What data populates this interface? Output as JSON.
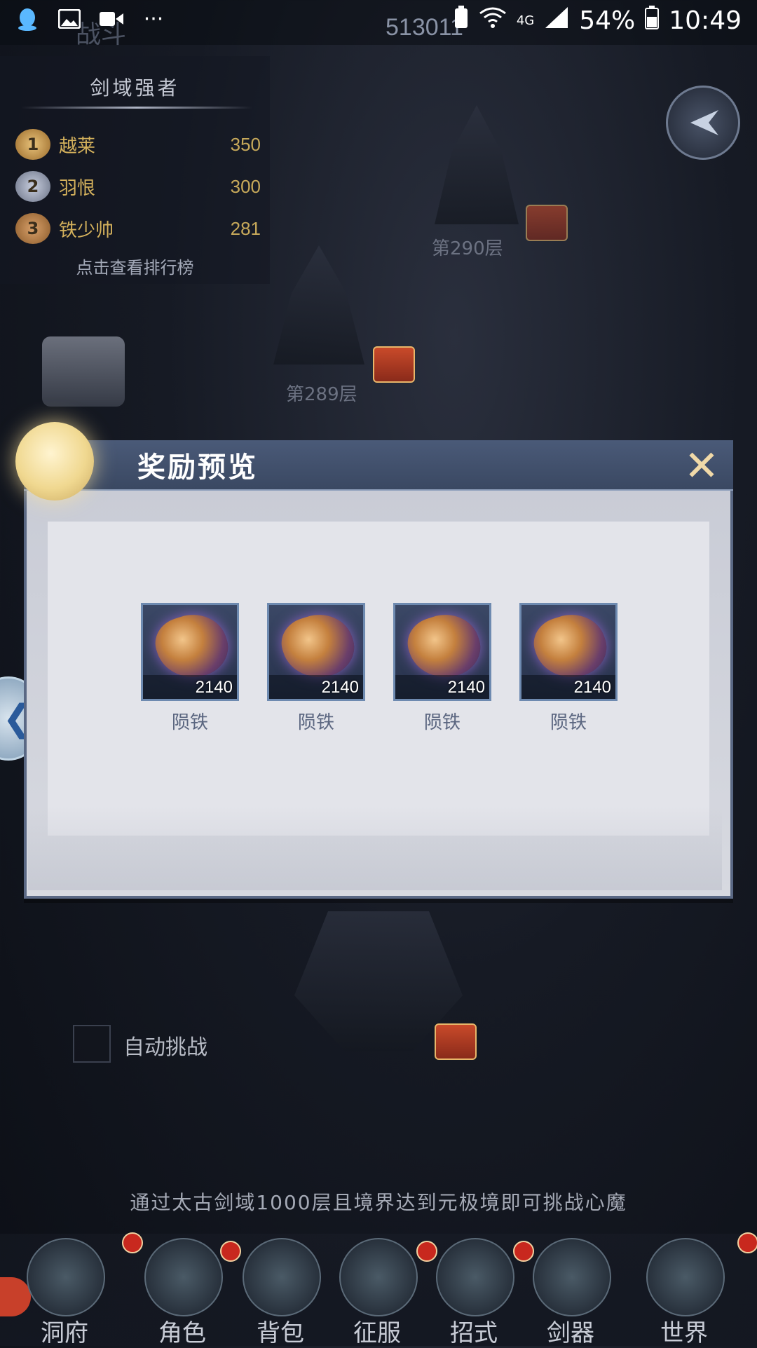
{
  "status_bar": {
    "battery": "54%",
    "time": "10:49",
    "network": "4G",
    "faint_title": "战斗",
    "faint_score": "513011",
    "icons": [
      "qq-icon",
      "image-icon",
      "video-icon",
      "more-icon",
      "battery-saver-icon",
      "wifi-icon",
      "signal-icon",
      "battery-icon"
    ]
  },
  "leaderboard": {
    "title": "剑域强者",
    "entries": [
      {
        "rank": "1",
        "name": "越莱",
        "score": "350"
      },
      {
        "rank": "2",
        "name": "羽恨",
        "score": "300"
      },
      {
        "rank": "3",
        "name": "铁少帅",
        "score": "281"
      }
    ],
    "link": "点击查看排行榜"
  },
  "floors": {
    "floor_a": "第290层",
    "floor_b": "第289层"
  },
  "dialog": {
    "title": "奖励预览",
    "items": [
      {
        "name": "陨铁",
        "count": "2140",
        "icon": "meteoric-iron-icon"
      },
      {
        "name": "陨铁",
        "count": "2140",
        "icon": "meteoric-iron-icon"
      },
      {
        "name": "陨铁",
        "count": "2140",
        "icon": "meteoric-iron-icon"
      },
      {
        "name": "陨铁",
        "count": "2140",
        "icon": "meteoric-iron-icon"
      }
    ]
  },
  "auto_challenge": {
    "label": "自动挑战",
    "checked": false
  },
  "tip": "通过太古剑域1000层且境界达到元极境即可挑战心魔",
  "nav": [
    {
      "label": "洞府",
      "badge": true
    },
    {
      "label": "角色",
      "badge": true
    },
    {
      "label": "背包",
      "badge": true
    },
    {
      "label": "征服",
      "badge": true
    },
    {
      "label": "招式",
      "badge": true
    },
    {
      "label": "剑器",
      "badge": true
    },
    {
      "label": "世界",
      "badge": true
    }
  ],
  "colors": {
    "accent_gold": "#d4b15c",
    "badge_red": "#c8281e",
    "dialog_header": "#3a4862"
  }
}
